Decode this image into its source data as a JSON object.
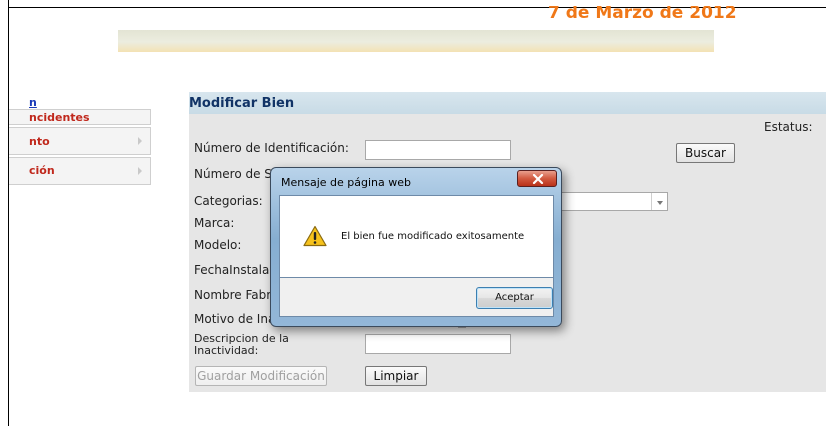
{
  "header": {
    "date": "7 de Marzo de 2012"
  },
  "sidebar": {
    "link_fragment": "n",
    "items": [
      {
        "label": "ncidentes"
      },
      {
        "label": "nto"
      },
      {
        "label": "ción"
      }
    ]
  },
  "form": {
    "title": "Modificar Bien",
    "estatus_label": "Estatus:",
    "labels": {
      "identificacion": "Número de Identificación:",
      "serie": "Número de S",
      "categorias": "Categorias:",
      "marca": "Marca:",
      "modelo": "Modelo:",
      "fecha": "FechaInstala",
      "fabricante": "Nombre Fabr",
      "motivo": "Motivo de Ina",
      "descripcion": "Descripcion de la Inactividad:"
    },
    "buttons": {
      "buscar": "Buscar",
      "guardar": "Guardar Modificación",
      "limpiar": "Limpiar"
    }
  },
  "dialog": {
    "title": "Mensaje de página web",
    "message": "El bien fue modificado exitosamente",
    "ok_label": "Aceptar"
  },
  "colors": {
    "date_orange": "#f07818",
    "sidebar_red": "#c0281c",
    "panel_bg": "#e6e6e6",
    "title_blue": "#113366"
  }
}
